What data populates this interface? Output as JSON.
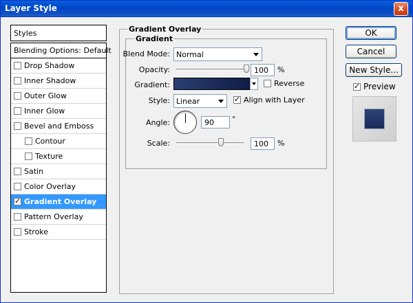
{
  "window": {
    "title": "Layer Style",
    "close": "x"
  },
  "sidebar": {
    "header": "Styles",
    "items": [
      {
        "label": "Blending Options: Default",
        "checkbox": false,
        "checked": false,
        "selected": false,
        "indent": false
      },
      {
        "label": "Drop Shadow",
        "checkbox": true,
        "checked": false,
        "selected": false,
        "indent": false
      },
      {
        "label": "Inner Shadow",
        "checkbox": true,
        "checked": false,
        "selected": false,
        "indent": false
      },
      {
        "label": "Outer Glow",
        "checkbox": true,
        "checked": false,
        "selected": false,
        "indent": false
      },
      {
        "label": "Inner Glow",
        "checkbox": true,
        "checked": false,
        "selected": false,
        "indent": false
      },
      {
        "label": "Bevel and Emboss",
        "checkbox": true,
        "checked": false,
        "selected": false,
        "indent": false
      },
      {
        "label": "Contour",
        "checkbox": true,
        "checked": false,
        "selected": false,
        "indent": true
      },
      {
        "label": "Texture",
        "checkbox": true,
        "checked": false,
        "selected": false,
        "indent": true
      },
      {
        "label": "Satin",
        "checkbox": true,
        "checked": false,
        "selected": false,
        "indent": false
      },
      {
        "label": "Color Overlay",
        "checkbox": true,
        "checked": false,
        "selected": false,
        "indent": false
      },
      {
        "label": "Gradient Overlay",
        "checkbox": true,
        "checked": true,
        "selected": true,
        "indent": false
      },
      {
        "label": "Pattern Overlay",
        "checkbox": true,
        "checked": false,
        "selected": false,
        "indent": false
      },
      {
        "label": "Stroke",
        "checkbox": true,
        "checked": false,
        "selected": false,
        "indent": false
      }
    ]
  },
  "panel": {
    "title": "Gradient Overlay",
    "group": "Gradient",
    "blend_mode_label": "Blend Mode:",
    "blend_mode_value": "Normal",
    "opacity_label": "Opacity:",
    "opacity_value": "100",
    "opacity_unit": "%",
    "opacity_fraction": 1.0,
    "gradient_label": "Gradient:",
    "reverse_label": "Reverse",
    "reverse_checked": false,
    "style_label": "Style:",
    "style_value": "Linear",
    "align_label": "Align with Layer",
    "align_checked": true,
    "angle_label": "Angle:",
    "angle_value": "90",
    "angle_unit": "°",
    "scale_label": "Scale:",
    "scale_value": "100",
    "scale_unit": "%",
    "scale_fraction": 0.66
  },
  "buttons": {
    "ok": "OK",
    "cancel": "Cancel",
    "new_style": "New Style..."
  },
  "preview": {
    "label": "Preview",
    "checked": true
  },
  "colors": {
    "selection": "#3399ff",
    "gradient_start": "#2a3f73",
    "gradient_end": "#101c44"
  }
}
